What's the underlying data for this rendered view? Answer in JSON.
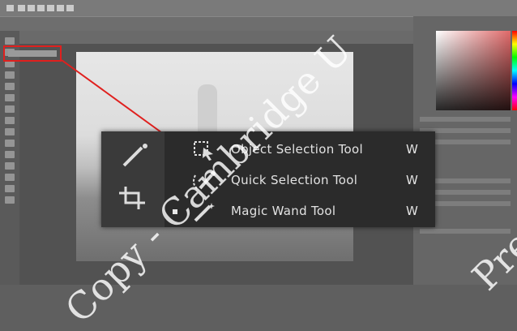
{
  "highlight": {
    "color": "#e0201e"
  },
  "flyout": {
    "items": [
      {
        "label": "Object Selection Tool",
        "shortcut": "W",
        "icon": "object-selection-icon",
        "active": false
      },
      {
        "label": "Quick Selection Tool",
        "shortcut": "W",
        "icon": "quick-selection-icon",
        "active": false
      },
      {
        "label": "Magic Wand Tool",
        "shortcut": "W",
        "icon": "magic-wand-icon",
        "active": true
      }
    ]
  },
  "watermark": {
    "left": "Copy - Cambridge U",
    "right": "Pre"
  }
}
